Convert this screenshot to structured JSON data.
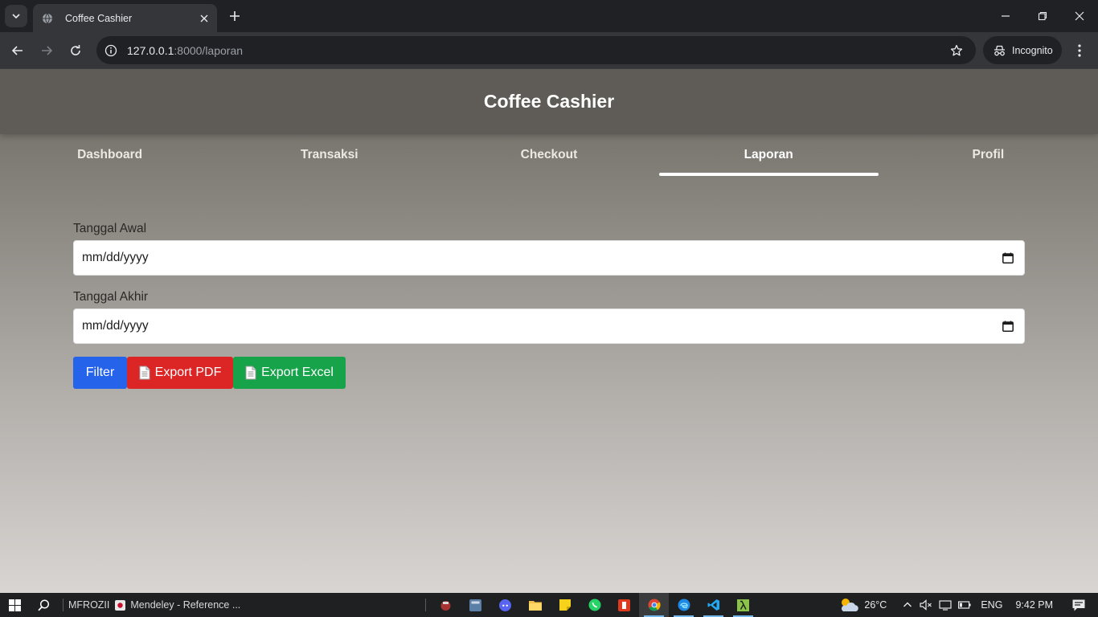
{
  "browser": {
    "tab_title": "Coffee Cashier",
    "url_host": "127.0.0.1",
    "url_path": ":8000/laporan",
    "incognito_label": "Incognito"
  },
  "app": {
    "title": "Coffee Cashier",
    "nav": [
      {
        "label": "Dashboard",
        "active": false
      },
      {
        "label": "Transaksi",
        "active": false
      },
      {
        "label": "Checkout",
        "active": false
      },
      {
        "label": "Laporan",
        "active": true
      },
      {
        "label": "Profil",
        "active": false
      }
    ]
  },
  "form": {
    "start_label": "Tanggal Awal",
    "start_value": "mm/dd/yyyy",
    "end_label": "Tanggal Akhir",
    "end_value": "mm/dd/yyyy",
    "filter_button": "Filter",
    "export_pdf_button": "Export PDF",
    "export_excel_button": "Export Excel"
  },
  "taskbar": {
    "user_label": "MFROZII",
    "window_title": "Mendeley - Reference ...",
    "weather_temp": "26°C",
    "language": "ENG",
    "time": "9:42 PM"
  },
  "colors": {
    "filter": "#2563eb",
    "export_pdf": "#dc2626",
    "export_excel": "#16a34a"
  }
}
